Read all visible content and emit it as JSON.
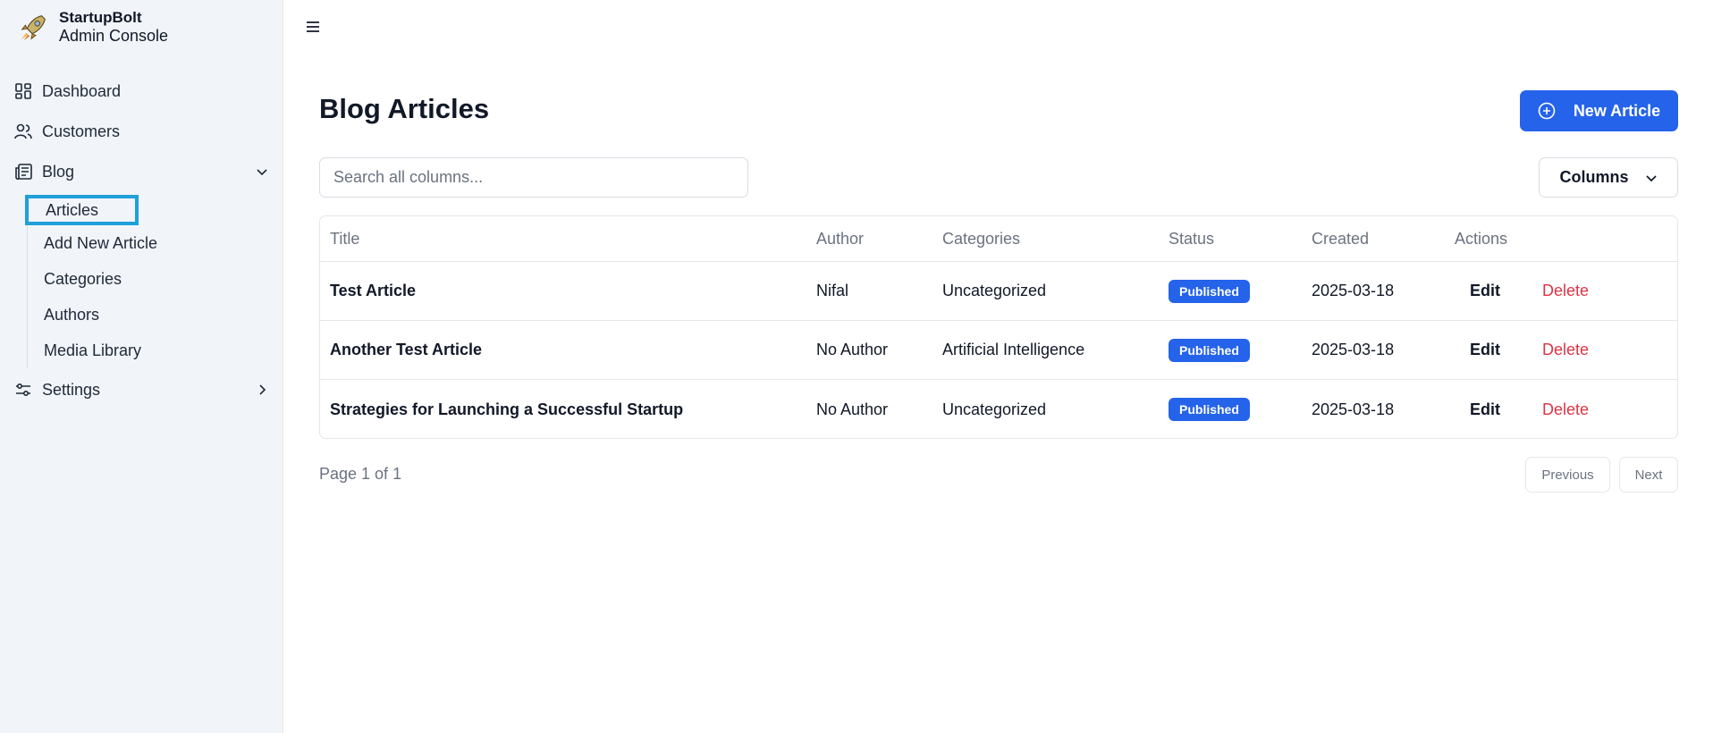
{
  "brand": {
    "name": "StartupBolt",
    "subtitle": "Admin Console",
    "logo_icon": "rocket-icon"
  },
  "sidebar": {
    "items": [
      {
        "label": "Dashboard",
        "icon": "dashboard-grid-icon"
      },
      {
        "label": "Customers",
        "icon": "users-icon"
      },
      {
        "label": "Blog",
        "icon": "newspaper-icon",
        "expanded": true
      },
      {
        "label": "Settings",
        "icon": "sliders-icon",
        "expanded": false
      }
    ],
    "blog_subitems": [
      {
        "label": "Articles",
        "active": true
      },
      {
        "label": "Add New Article"
      },
      {
        "label": "Categories"
      },
      {
        "label": "Authors"
      },
      {
        "label": "Media Library"
      }
    ]
  },
  "header": {
    "menu_icon": "hamburger-menu-icon"
  },
  "main": {
    "title": "Blog Articles",
    "new_button": "New Article",
    "search": {
      "placeholder": "Search all columns...",
      "value": ""
    },
    "columns_button": "Columns",
    "table": {
      "columns": [
        "Title",
        "Author",
        "Categories",
        "Status",
        "Created",
        "Actions"
      ],
      "rows": [
        {
          "title": "Test Article",
          "author": "Nifal",
          "categories": "Uncategorized",
          "status": "Published",
          "created": "2025-03-18",
          "edit": "Edit",
          "delete": "Delete"
        },
        {
          "title": "Another Test Article",
          "author": "No Author",
          "categories": "Artificial Intelligence",
          "status": "Published",
          "created": "2025-03-18",
          "edit": "Edit",
          "delete": "Delete"
        },
        {
          "title": "Strategies for Launching a Successful Startup",
          "author": "No Author",
          "categories": "Uncategorized",
          "status": "Published",
          "created": "2025-03-18",
          "edit": "Edit",
          "delete": "Delete"
        }
      ]
    },
    "pagination": {
      "info": "Page 1 of 1",
      "previous": "Previous",
      "next": "Next"
    }
  },
  "colors": {
    "primary": "#2563eb",
    "danger": "#dc3545",
    "sidebar_bg": "#f1f4f9",
    "active_outline": "#1ea0d8"
  }
}
